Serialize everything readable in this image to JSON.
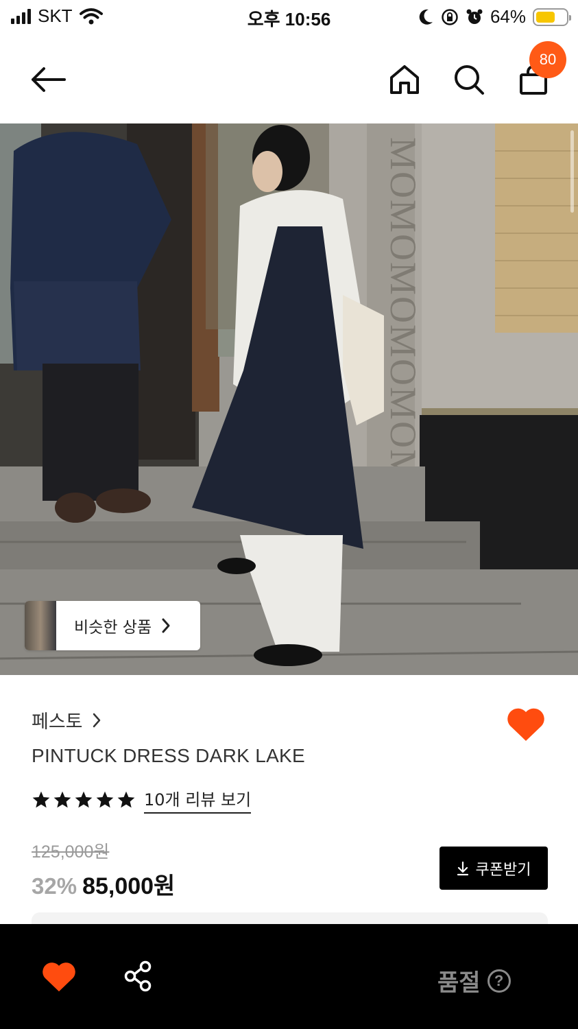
{
  "status_bar": {
    "carrier": "SKT",
    "time": "오후 10:56",
    "battery_percent": "64%",
    "battery_level": 0.64,
    "battery_color": "#f7c600"
  },
  "nav": {
    "back_icon": "arrow-left-icon",
    "home_icon": "home-icon",
    "search_icon": "search-icon",
    "cart_icon": "bag-icon",
    "cart_badge": "80"
  },
  "hero": {
    "similar_products_label": "비슷한 상품"
  },
  "product": {
    "brand": "페스토",
    "title": "PINTUCK DRESS DARK LAKE",
    "rating_stars": 5,
    "review_link": "10개 리뷰 보기",
    "original_price": "125,000원",
    "discount": "32%",
    "sale_price": "85,000원",
    "coupon_label": "쿠폰받기",
    "wishlisted": true
  },
  "bottom_bar": {
    "soldout_label": "품절",
    "help_glyph": "?"
  },
  "colors": {
    "accent": "#ff5a16",
    "heart": "#ff4c0f",
    "bottom_bar_bg": "#000000"
  }
}
